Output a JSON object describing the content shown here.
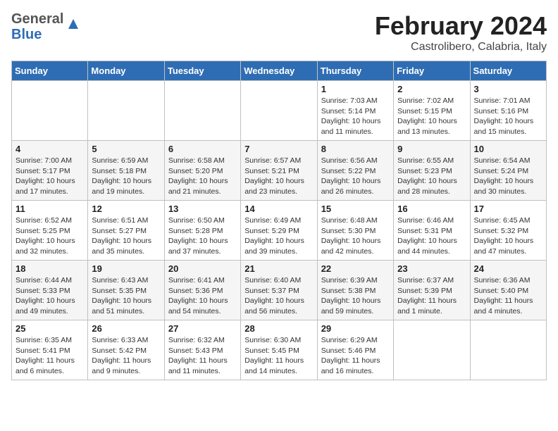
{
  "header": {
    "logo_general": "General",
    "logo_blue": "Blue",
    "month_title": "February 2024",
    "location": "Castrolibero, Calabria, Italy"
  },
  "weekdays": [
    "Sunday",
    "Monday",
    "Tuesday",
    "Wednesday",
    "Thursday",
    "Friday",
    "Saturday"
  ],
  "weeks": [
    [
      {
        "day": "",
        "info": ""
      },
      {
        "day": "",
        "info": ""
      },
      {
        "day": "",
        "info": ""
      },
      {
        "day": "",
        "info": ""
      },
      {
        "day": "1",
        "info": "Sunrise: 7:03 AM\nSunset: 5:14 PM\nDaylight: 10 hours\nand 11 minutes."
      },
      {
        "day": "2",
        "info": "Sunrise: 7:02 AM\nSunset: 5:15 PM\nDaylight: 10 hours\nand 13 minutes."
      },
      {
        "day": "3",
        "info": "Sunrise: 7:01 AM\nSunset: 5:16 PM\nDaylight: 10 hours\nand 15 minutes."
      }
    ],
    [
      {
        "day": "4",
        "info": "Sunrise: 7:00 AM\nSunset: 5:17 PM\nDaylight: 10 hours\nand 17 minutes."
      },
      {
        "day": "5",
        "info": "Sunrise: 6:59 AM\nSunset: 5:18 PM\nDaylight: 10 hours\nand 19 minutes."
      },
      {
        "day": "6",
        "info": "Sunrise: 6:58 AM\nSunset: 5:20 PM\nDaylight: 10 hours\nand 21 minutes."
      },
      {
        "day": "7",
        "info": "Sunrise: 6:57 AM\nSunset: 5:21 PM\nDaylight: 10 hours\nand 23 minutes."
      },
      {
        "day": "8",
        "info": "Sunrise: 6:56 AM\nSunset: 5:22 PM\nDaylight: 10 hours\nand 26 minutes."
      },
      {
        "day": "9",
        "info": "Sunrise: 6:55 AM\nSunset: 5:23 PM\nDaylight: 10 hours\nand 28 minutes."
      },
      {
        "day": "10",
        "info": "Sunrise: 6:54 AM\nSunset: 5:24 PM\nDaylight: 10 hours\nand 30 minutes."
      }
    ],
    [
      {
        "day": "11",
        "info": "Sunrise: 6:52 AM\nSunset: 5:25 PM\nDaylight: 10 hours\nand 32 minutes."
      },
      {
        "day": "12",
        "info": "Sunrise: 6:51 AM\nSunset: 5:27 PM\nDaylight: 10 hours\nand 35 minutes."
      },
      {
        "day": "13",
        "info": "Sunrise: 6:50 AM\nSunset: 5:28 PM\nDaylight: 10 hours\nand 37 minutes."
      },
      {
        "day": "14",
        "info": "Sunrise: 6:49 AM\nSunset: 5:29 PM\nDaylight: 10 hours\nand 39 minutes."
      },
      {
        "day": "15",
        "info": "Sunrise: 6:48 AM\nSunset: 5:30 PM\nDaylight: 10 hours\nand 42 minutes."
      },
      {
        "day": "16",
        "info": "Sunrise: 6:46 AM\nSunset: 5:31 PM\nDaylight: 10 hours\nand 44 minutes."
      },
      {
        "day": "17",
        "info": "Sunrise: 6:45 AM\nSunset: 5:32 PM\nDaylight: 10 hours\nand 47 minutes."
      }
    ],
    [
      {
        "day": "18",
        "info": "Sunrise: 6:44 AM\nSunset: 5:33 PM\nDaylight: 10 hours\nand 49 minutes."
      },
      {
        "day": "19",
        "info": "Sunrise: 6:43 AM\nSunset: 5:35 PM\nDaylight: 10 hours\nand 51 minutes."
      },
      {
        "day": "20",
        "info": "Sunrise: 6:41 AM\nSunset: 5:36 PM\nDaylight: 10 hours\nand 54 minutes."
      },
      {
        "day": "21",
        "info": "Sunrise: 6:40 AM\nSunset: 5:37 PM\nDaylight: 10 hours\nand 56 minutes."
      },
      {
        "day": "22",
        "info": "Sunrise: 6:39 AM\nSunset: 5:38 PM\nDaylight: 10 hours\nand 59 minutes."
      },
      {
        "day": "23",
        "info": "Sunrise: 6:37 AM\nSunset: 5:39 PM\nDaylight: 11 hours\nand 1 minute."
      },
      {
        "day": "24",
        "info": "Sunrise: 6:36 AM\nSunset: 5:40 PM\nDaylight: 11 hours\nand 4 minutes."
      }
    ],
    [
      {
        "day": "25",
        "info": "Sunrise: 6:35 AM\nSunset: 5:41 PM\nDaylight: 11 hours\nand 6 minutes."
      },
      {
        "day": "26",
        "info": "Sunrise: 6:33 AM\nSunset: 5:42 PM\nDaylight: 11 hours\nand 9 minutes."
      },
      {
        "day": "27",
        "info": "Sunrise: 6:32 AM\nSunset: 5:43 PM\nDaylight: 11 hours\nand 11 minutes."
      },
      {
        "day": "28",
        "info": "Sunrise: 6:30 AM\nSunset: 5:45 PM\nDaylight: 11 hours\nand 14 minutes."
      },
      {
        "day": "29",
        "info": "Sunrise: 6:29 AM\nSunset: 5:46 PM\nDaylight: 11 hours\nand 16 minutes."
      },
      {
        "day": "",
        "info": ""
      },
      {
        "day": "",
        "info": ""
      }
    ]
  ]
}
